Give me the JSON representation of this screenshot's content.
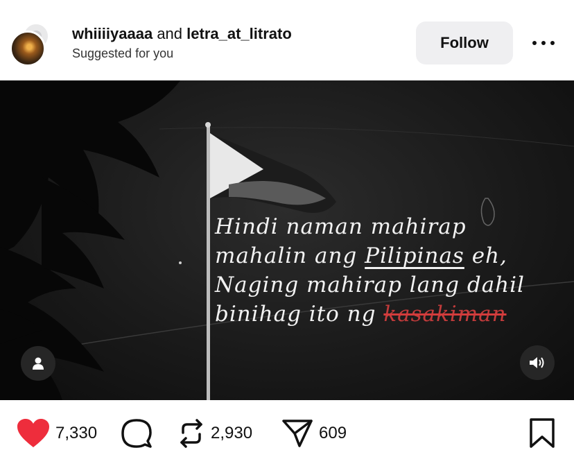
{
  "post": {
    "authors": "whiiiiyaaaa",
    "and": "and",
    "coauthor": "letra_at_litrato",
    "suggestion": "Suggested for you",
    "follow_label": "Follow"
  },
  "media": {
    "caption_lines": [
      "Hindi naman mahirap",
      "mahalin ang",
      "Pilipinas",
      "eh,",
      "Naging mahirap lang dahil",
      "binihag ito ng",
      "kasakiman"
    ]
  },
  "engagement": {
    "likes": "7,330",
    "reposts": "2,930",
    "shares": "609"
  },
  "colors": {
    "heart": "#ee2d3c",
    "follow_bg": "#efeff1",
    "strike": "#d43c3c"
  },
  "icons": [
    "avatar",
    "more-icon",
    "user-tag-icon",
    "sound-icon",
    "heart-icon",
    "comment-icon",
    "repost-icon",
    "share-icon",
    "bookmark-icon"
  ]
}
